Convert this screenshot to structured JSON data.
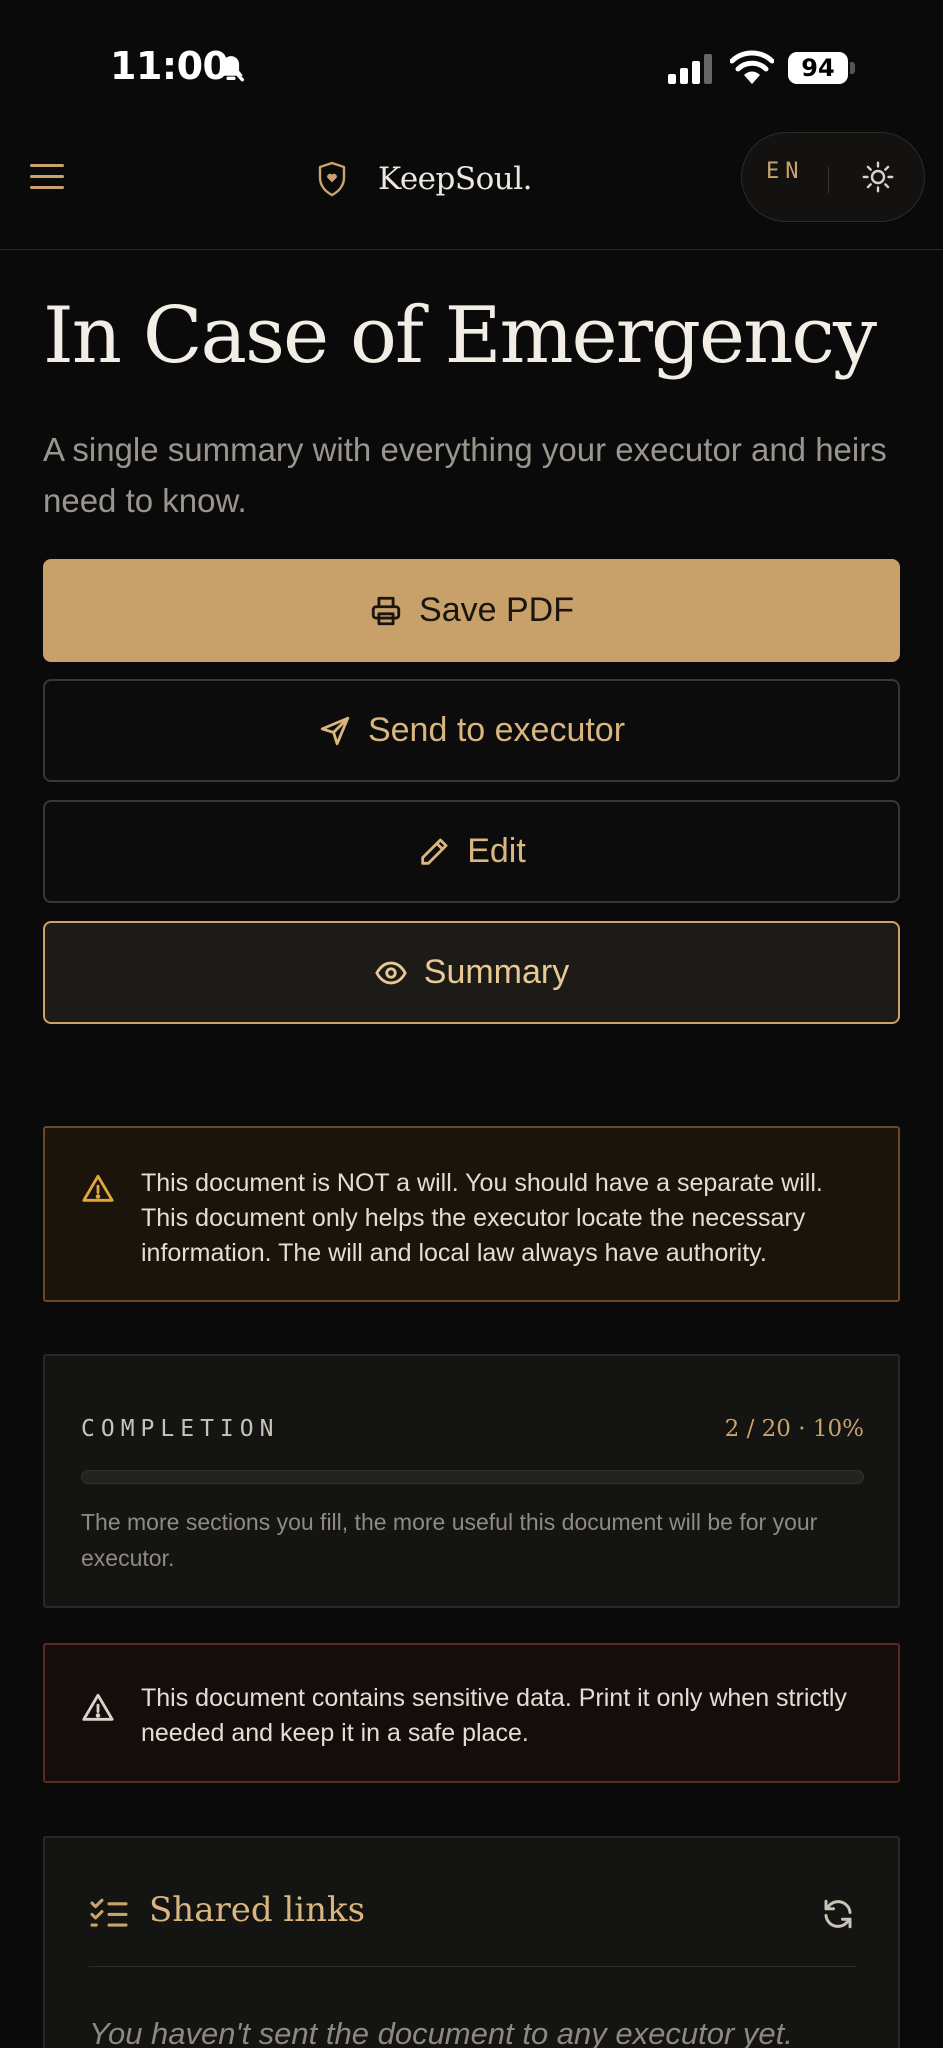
{
  "status_bar": {
    "time": "11:00",
    "battery": "94"
  },
  "header": {
    "brand": "KeepSoul.",
    "language": "EN"
  },
  "hero": {
    "title": "In Case of Emergency",
    "subtitle": "A single summary with everything your executor and heirs need to know."
  },
  "actions": {
    "save_pdf": "Save PDF",
    "send": "Send to executor",
    "edit": "Edit",
    "summary": "Summary"
  },
  "notices": {
    "will": "This document is NOT a will. You should have a separate will. This document only helps the executor locate the necessary information. The will and local law always have authority.",
    "sensitive": "This document contains sensitive data. Print it only when strictly needed and keep it in a safe place."
  },
  "completion": {
    "label": "COMPLETION",
    "stats": "2 / 20 · 10%",
    "progress_fraction": 0.1,
    "hint": "The more sections you fill, the more useful this document will be for your executor."
  },
  "shared_links": {
    "title": "Shared links",
    "empty": "You haven't sent the document to any executor yet."
  },
  "colors": {
    "accent": "#c7a169",
    "background": "#0a0a0a",
    "warning_border": "#6a4a24",
    "danger_border": "#5a2a21"
  },
  "icons": {
    "menu": "menu-icon",
    "brand": "shield-heart-icon",
    "theme": "sun-icon",
    "save": "printer-icon",
    "send": "send-icon",
    "edit": "pencil-icon",
    "summary": "eye-icon",
    "warning": "warning-icon",
    "links": "checklist-icon",
    "refresh": "refresh-icon"
  }
}
